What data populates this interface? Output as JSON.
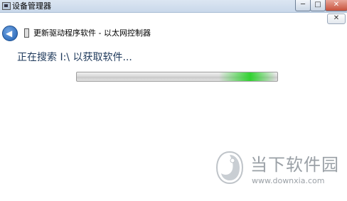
{
  "window": {
    "title": "设备管理器",
    "min_glyph": "─",
    "max_glyph": "□",
    "close_glyph": "✕"
  },
  "dialog": {
    "close_glyph": "✕",
    "header_title": "更新驱动程序软件 - 以太网控制器",
    "status_text": "正在搜索 I:\\ 以获取软件...",
    "progress": {
      "indeterminate": true,
      "glow_position": 0.85,
      "color": "#2dcc2d"
    }
  },
  "watermark": {
    "name": "当下软件园",
    "url": "www.downxia.com"
  },
  "icons": {
    "app": "device-manager-icon",
    "back": "back-arrow-icon",
    "device": "network-device-icon",
    "watermark": "downxia-logo-icon"
  }
}
